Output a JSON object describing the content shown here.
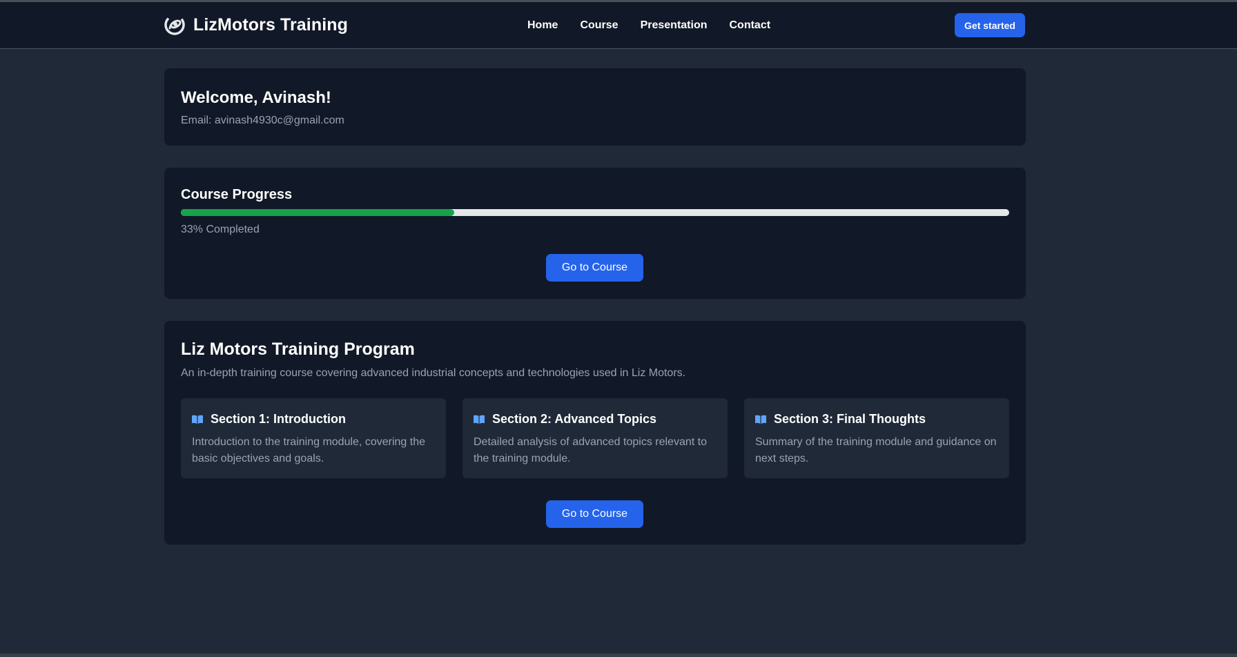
{
  "brand": {
    "name": "LizMotors Training",
    "logo_icon": "swirl-logo-icon"
  },
  "nav": {
    "links": [
      "Home",
      "Course",
      "Presentation",
      "Contact"
    ],
    "active": "Home",
    "cta_label": "Get started"
  },
  "welcome": {
    "heading": "Welcome, Avinash!",
    "email_label": "Email:",
    "email": "avinash4930c@gmail.com"
  },
  "progress": {
    "title": "Course Progress",
    "percent": 33,
    "status_text": "33% Completed",
    "button_label": "Go to Course"
  },
  "program": {
    "title": "Liz Motors Training Program",
    "description": "An in-depth training course covering advanced industrial concepts and technologies used in Liz Motors.",
    "sections": [
      {
        "icon": "book-open-icon",
        "title": "Section 1: Introduction",
        "description": "Introduction to the training module, covering the basic objectives and goals."
      },
      {
        "icon": "book-open-icon",
        "title": "Section 2: Advanced Topics",
        "description": "Detailed analysis of advanced topics relevant to the training module."
      },
      {
        "icon": "book-open-icon",
        "title": "Section 3: Final Thoughts",
        "description": "Summary of the training module and guidance on next steps."
      }
    ],
    "button_label": "Go to Course"
  },
  "colors": {
    "background": "#1f2937",
    "card": "#111827",
    "accent": "#2563eb",
    "progress_fill": "#16a34a",
    "progress_track": "#e5e7eb",
    "muted_text": "#9ca3af",
    "icon_blue": "#60a5fa"
  }
}
